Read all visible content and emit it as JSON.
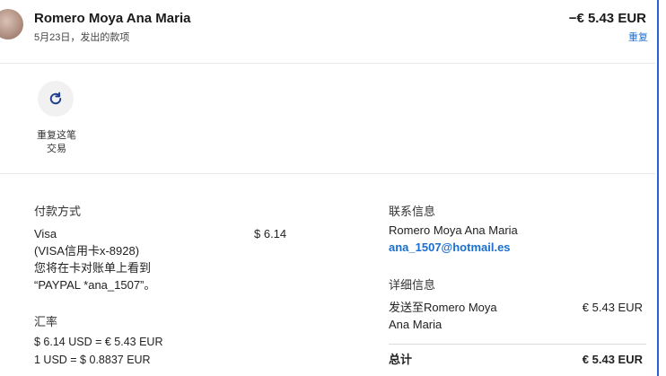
{
  "header": {
    "name": "Romero Moya Ana Maria",
    "date": "5月23日，发出的款项",
    "amount": "−€ 5.43 EUR",
    "repeat_label": "重复"
  },
  "action": {
    "label_line1": "重复这笔",
    "label_line2": "交易",
    "icon": "refresh-icon"
  },
  "payment_method": {
    "title": "付款方式",
    "card_name": "Visa",
    "card_amount": "$ 6.14",
    "card_detail": "(VISA信用卡x-8928)",
    "statement_line1": "您将在卡对账单上看到",
    "statement_line2": "“PAYPAL *ana_1507”。"
  },
  "exchange_rate": {
    "title": "汇率",
    "line1": "$ 6.14 USD = € 5.43 EUR",
    "line2": "1 USD = $ 0.8837 EUR"
  },
  "contact": {
    "title": "联系信息",
    "name": "Romero Moya Ana Maria",
    "email": "ana_1507@hotmail.es"
  },
  "details": {
    "title": "详细信息",
    "sent_to_line1": "发送至Romero Moya",
    "sent_to_line2": "Ana Maria",
    "sent_amount": "€ 5.43 EUR",
    "total_label": "总计",
    "total_amount": "€ 5.43 EUR"
  },
  "colors": {
    "accent": "#1a6fd0",
    "right_rule": "#2b5fd8"
  }
}
